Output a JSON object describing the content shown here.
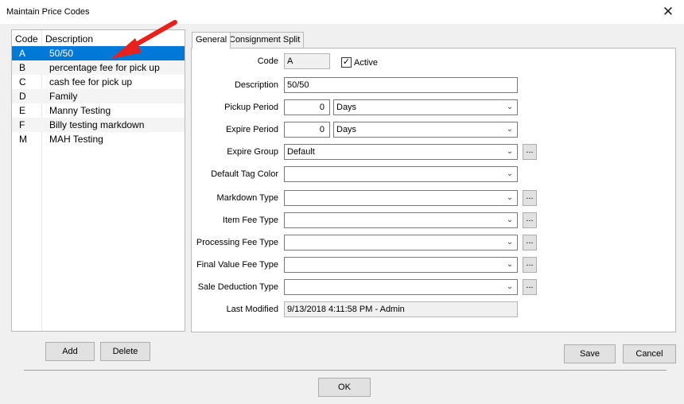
{
  "window": {
    "title": "Maintain Price Codes",
    "close_glyph": "✕"
  },
  "list": {
    "headers": {
      "code": "Code",
      "description": "Description"
    },
    "rows": [
      {
        "code": "A",
        "description": "50/50",
        "selected": true
      },
      {
        "code": "B",
        "description": "percentage fee for pick up"
      },
      {
        "code": "C",
        "description": "cash fee for pick up"
      },
      {
        "code": "D",
        "description": "Family"
      },
      {
        "code": "E",
        "description": "Manny Testing"
      },
      {
        "code": "F",
        "description": "Billy testing markdown"
      },
      {
        "code": "M",
        "description": "MAH Testing"
      }
    ]
  },
  "buttons": {
    "add": "Add",
    "delete": "Delete",
    "save": "Save",
    "cancel": "Cancel",
    "ok": "OK",
    "ellipsis": "..."
  },
  "tabs": {
    "general": "General",
    "consignment": "Consignment Split"
  },
  "form": {
    "code": {
      "label": "Code",
      "value": "A"
    },
    "active": {
      "label": "Active",
      "checked": true,
      "glyph": "✓"
    },
    "description": {
      "label": "Description",
      "value": "50/50"
    },
    "pickup_period": {
      "label": "Pickup Period",
      "value": "0",
      "unit": "Days"
    },
    "expire_period": {
      "label": "Expire Period",
      "value": "0",
      "unit": "Days"
    },
    "expire_group": {
      "label": "Expire Group",
      "value": "Default"
    },
    "default_tag_color": {
      "label": "Default Tag Color",
      "value": ""
    },
    "markdown_type": {
      "label": "Markdown Type",
      "value": ""
    },
    "item_fee_type": {
      "label": "Item Fee Type",
      "value": ""
    },
    "processing_fee_type": {
      "label": "Processing Fee Type",
      "value": ""
    },
    "final_value_fee_type": {
      "label": "Final Value Fee Type",
      "value": ""
    },
    "sale_deduction_type": {
      "label": "Sale Deduction Type",
      "value": ""
    },
    "last_modified": {
      "label": "Last Modified",
      "value": "9/13/2018 4:11:58 PM - Admin"
    }
  },
  "icons": {
    "chevron": "chevron-down-icon",
    "arrow": "red-arrow-annotation"
  },
  "colors": {
    "selection": "#0078d7",
    "arrow": "#e8211c"
  }
}
